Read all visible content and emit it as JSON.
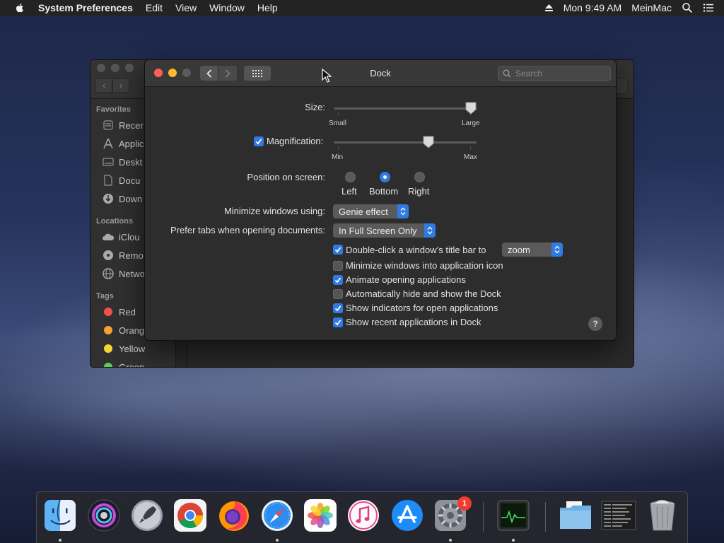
{
  "menubar": {
    "app_name": "System Preferences",
    "menus": [
      "Edit",
      "View",
      "Window",
      "Help"
    ],
    "clock": "Mon 9:49 AM",
    "user": "MeinMac"
  },
  "finder": {
    "favorites_title": "Favorites",
    "favorites": [
      "Recer",
      "Applic",
      "Deskt",
      "Docu",
      "Down"
    ],
    "locations_title": "Locations",
    "locations": [
      "iClou",
      "Remo",
      "Netwo"
    ],
    "tags_title": "Tags",
    "tags": [
      {
        "label": "Red",
        "color": "#f0504a"
      },
      {
        "label": "Orang",
        "color": "#f4a232"
      },
      {
        "label": "Yellow",
        "color": "#f6d62e"
      },
      {
        "label": "Green",
        "color": "#5bd056"
      }
    ]
  },
  "window": {
    "title": "Dock",
    "search_placeholder": "Search"
  },
  "dock_prefs": {
    "size_label": "Size:",
    "size_min_label": "Small",
    "size_max_label": "Large",
    "size_value": 1.0,
    "magnification_label": "Magnification:",
    "magnification_checked": true,
    "mag_min_label": "Min",
    "mag_max_label": "Max",
    "magnification_value": 0.68,
    "position_label": "Position on screen:",
    "positions": [
      "Left",
      "Bottom",
      "Right"
    ],
    "position_selected": "Bottom",
    "minimize_label": "Minimize windows using:",
    "minimize_value": "Genie effect",
    "tabs_label": "Prefer tabs when opening documents:",
    "tabs_value": "In Full Screen Only",
    "double_click_label": "Double-click a window’s title bar to",
    "double_click_value": "zoom",
    "options": [
      {
        "label": "Double-click a window’s title bar to",
        "checked": true
      },
      {
        "label": "Minimize windows into application icon",
        "checked": false
      },
      {
        "label": "Animate opening applications",
        "checked": true
      },
      {
        "label": "Automatically hide and show the Dock",
        "checked": false
      },
      {
        "label": "Show indicators for open applications",
        "checked": true
      },
      {
        "label": "Show recent applications in Dock",
        "checked": true
      }
    ],
    "help_label": "?"
  },
  "dock": {
    "apps": [
      "finder-icon",
      "siri-icon",
      "launchpad-icon",
      "chrome-icon",
      "firefox-icon",
      "safari-icon",
      "photos-icon",
      "itunes-icon",
      "app-store-icon",
      "system-preferences-icon",
      "activity-monitor-icon",
      "folder-icon",
      "stack-icon",
      "trash-icon"
    ],
    "system_prefs_badge": "1"
  },
  "colors": {
    "accent": "#2f7ae5",
    "window_bg": "#2d2d2d",
    "menubar_bg": "#232323"
  }
}
